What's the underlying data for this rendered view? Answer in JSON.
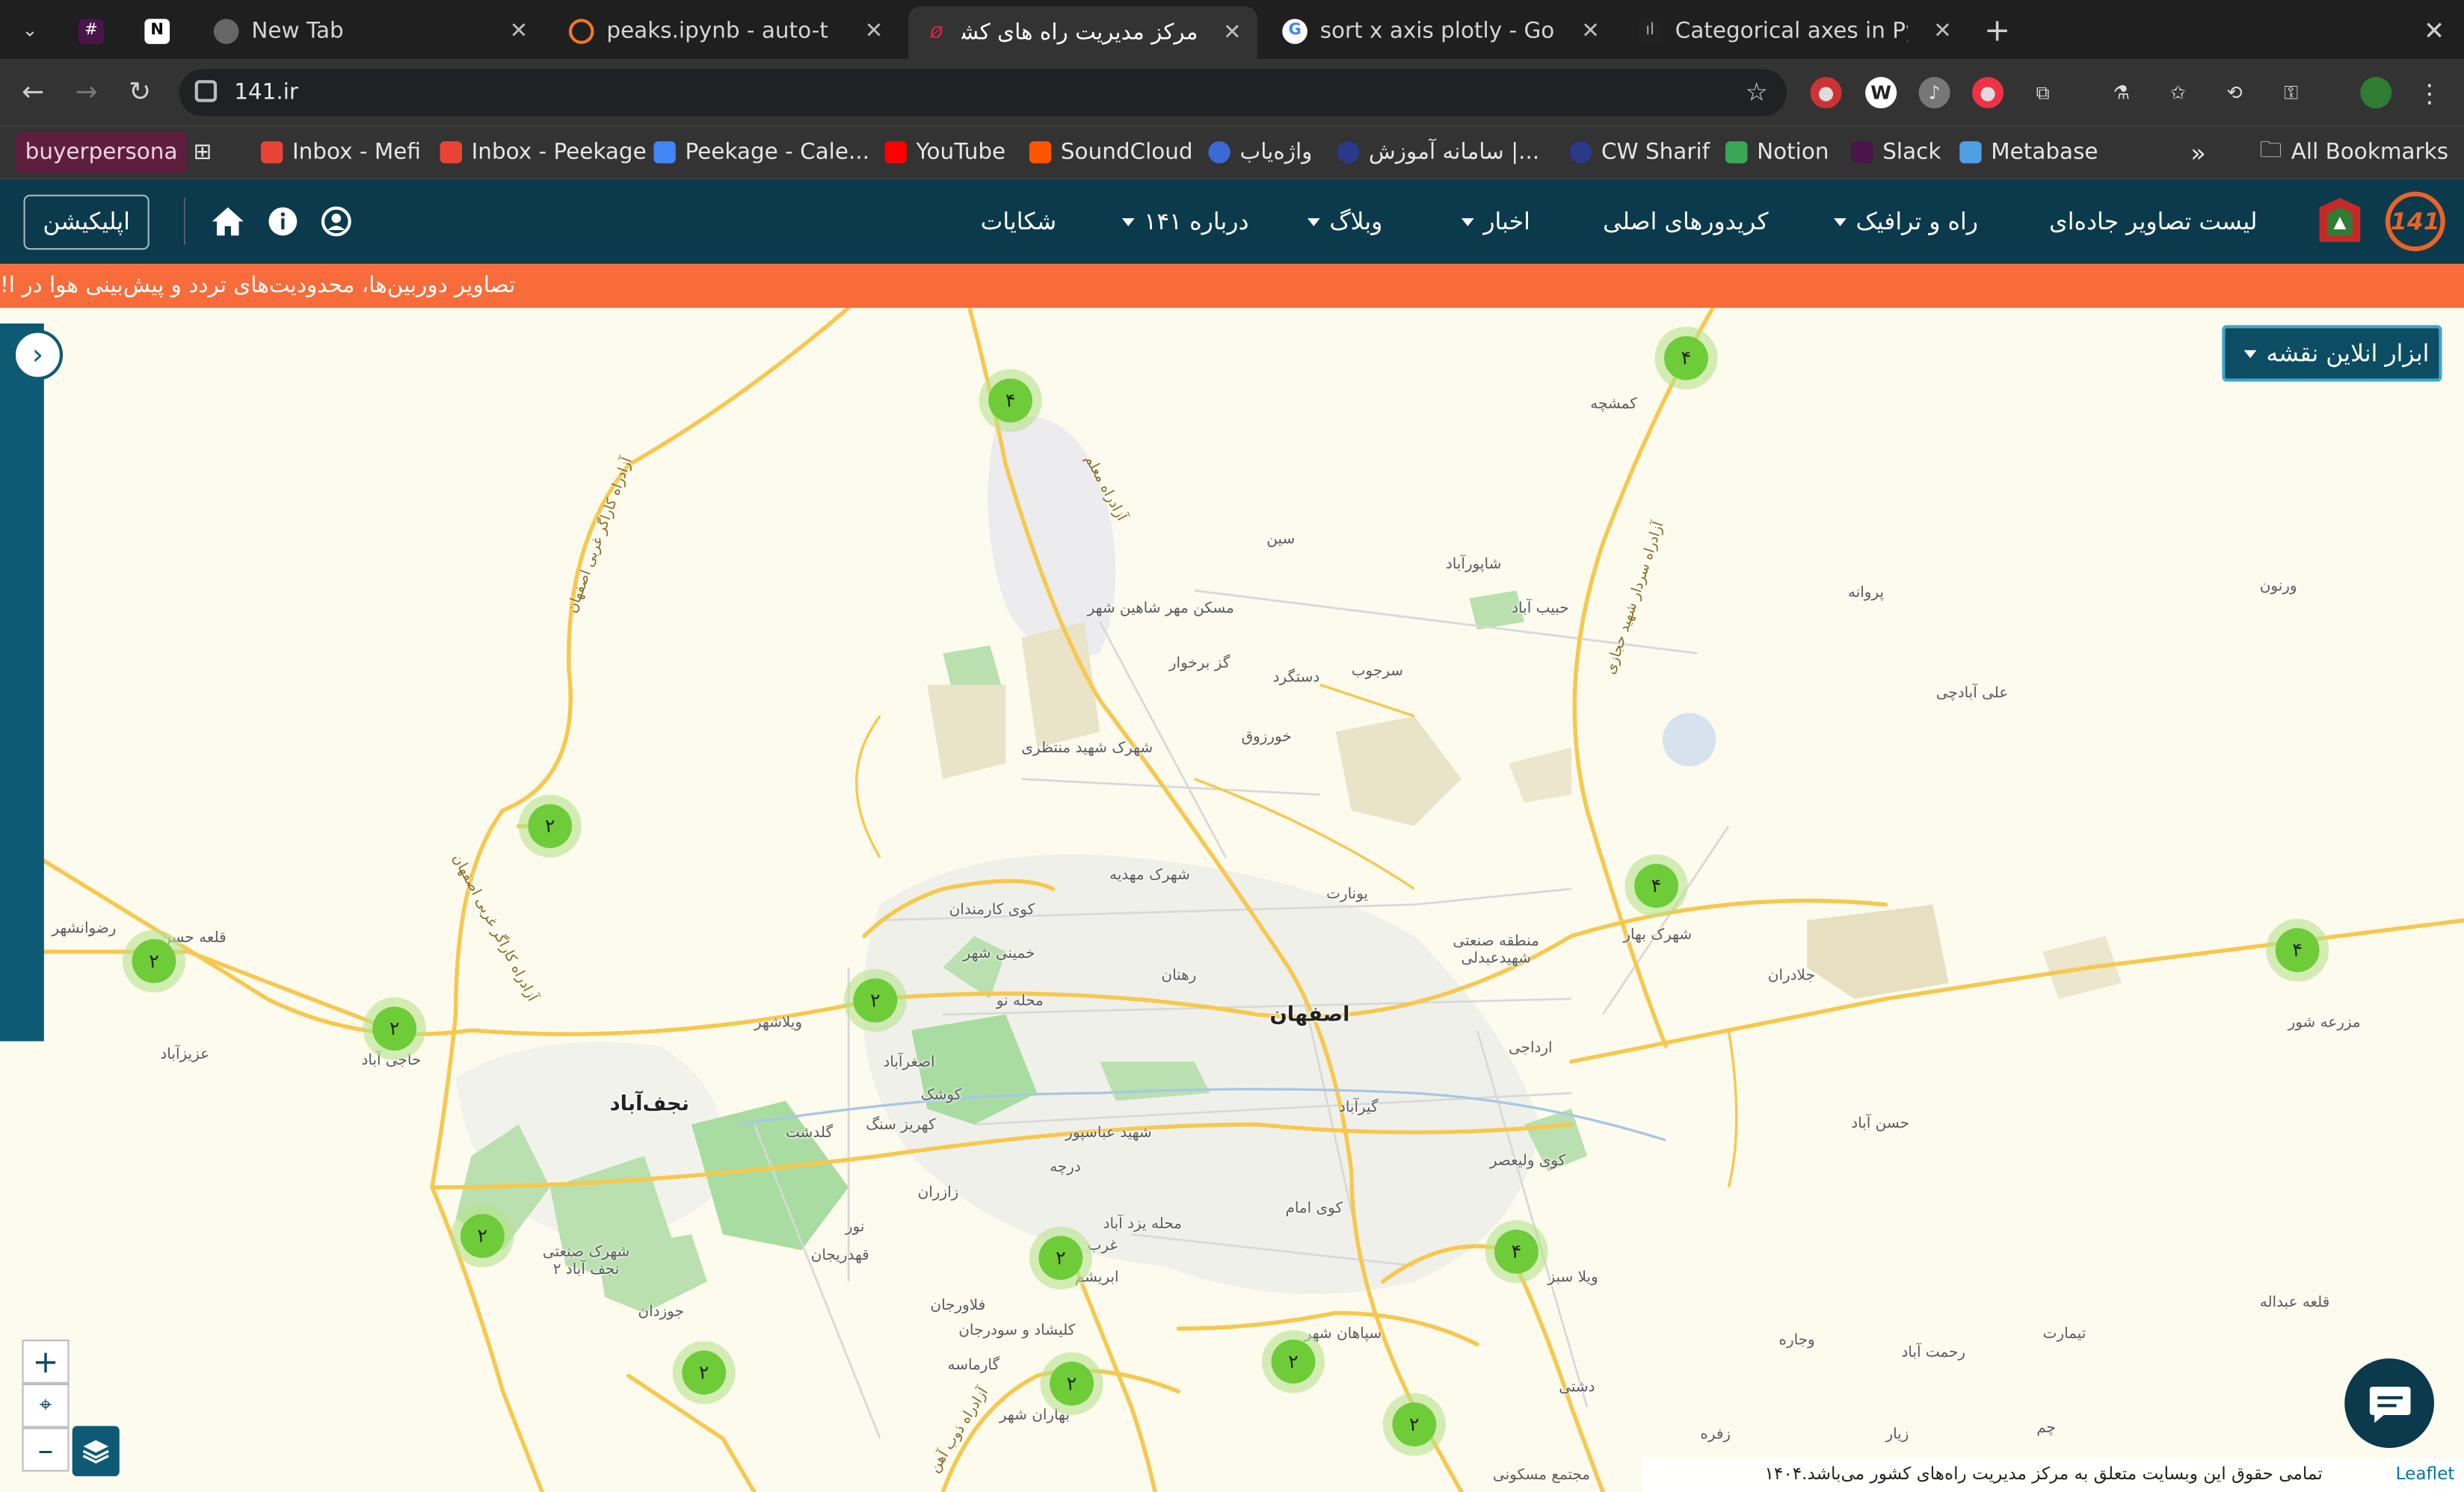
{
  "browser": {
    "tabs": [
      {
        "title": "",
        "icon": "slack-icon"
      },
      {
        "title": "",
        "icon": "notion-icon"
      },
      {
        "title": "New Tab",
        "icon": "chrome-icon"
      },
      {
        "title": "peaks.ipynb - auto-t",
        "icon": "jupyter-icon"
      },
      {
        "title": "مرکز مدیریت راه های کشور",
        "icon": "141-icon"
      },
      {
        "title": "sort x axis plotly - Google",
        "icon": "google-icon"
      },
      {
        "title": "Categorical axes in Pytho",
        "icon": "plotly-icon"
      }
    ],
    "url": "141.ir",
    "bookmarks": [
      "buyerpersona",
      "Inbox - Mefi",
      "Inbox - Peekage",
      "Peekage - Cale...",
      "YouTube",
      "SoundCloud",
      "واژه‌یاب",
      "سامانه آموزش |...",
      "CW Sharif",
      "Notion",
      "Slack",
      "Metabase"
    ],
    "all_bookmarks": "All Bookmarks",
    "more": "»"
  },
  "header": {
    "menu": [
      {
        "label": "لیست تصاویر جاده‌ای",
        "dropdown": false
      },
      {
        "label": "راه و ترافیک",
        "dropdown": true
      },
      {
        "label": "کریدورهای اصلی",
        "dropdown": false
      },
      {
        "label": "اخبار",
        "dropdown": true
      },
      {
        "label": "وبلاگ",
        "dropdown": true
      },
      {
        "label": "درباره ۱۴۱",
        "dropdown": true
      },
      {
        "label": "شکایات",
        "dropdown": false
      }
    ],
    "app_button": "اپلیکیشن"
  },
  "banner": "تصاویر دوربین‌ها، محدودیت‌های تردد و پیش‌بینی هوا در ا!",
  "map": {
    "tools_button": "ابزار انلاین نقشه",
    "city": "اصفهان",
    "places": [
      "نجف‌آباد",
      "کمشچه",
      "شاپورآباد",
      "سین",
      "حبیب آباد",
      "سرجوب",
      "دستگرد",
      "گز برخوار",
      "مسکن مهر شاهین شهر",
      "خورزوق",
      "شهرک شهید منتظری",
      "شهرک مهدیه",
      "کوی کارمندان",
      "خمینی شهر",
      "محله نو",
      "رهنان",
      "یونارت",
      "منطقه صنعتی شهیدعبدلی",
      "شهرک بهار",
      "جلادران",
      "پروانه",
      "ورنون",
      "علی آبادچی",
      "مزرعه شور",
      "حسن آباد",
      "ارداجی",
      "گیرآباد",
      "کوی ولیعصر",
      "کوی امام",
      "شهید عباسپور",
      "درچه",
      "کوشک",
      "کهریز سنگ",
      "اصغرآباد",
      "ویلاشهر",
      "گلدشت",
      "زازران",
      "محله یزد آباد",
      "ابریشم",
      "غرب",
      "نور",
      "قهدریجان",
      "فلاورجان",
      "جوزدان",
      "کلیشاد و سودرجان",
      "گارماسه",
      "بهاران شهر",
      "سپاهان شهر",
      "دشتی",
      "زفره",
      "زیار",
      "وجاره",
      "رحمت آباد",
      "تیمارت",
      "قلعه عبداله",
      "ویلا سبز",
      "مجتمع مسکونی",
      "حاجی آباد",
      "عزیزآباد",
      "قلعه حسن",
      "رضوانشهر",
      "شهرک صنعتی نجف آباد ۲",
      "چم"
    ],
    "roads": [
      "آزادراه کاراگر غربی اصفهان",
      "آزادراه معلم",
      "آزادراه سردار شهید حجازی",
      "آزادراه ذوب آهن",
      "آزادراه کاراگر غربی اصفهان"
    ],
    "clusters": [
      "۴",
      "۴",
      "۲",
      "۲",
      "۲",
      "۲",
      "۴",
      "۴",
      "۲",
      "۲",
      "۴",
      "۲",
      "۲",
      "۲",
      "۲"
    ],
    "zoom_in": "+",
    "zoom_out": "–",
    "footer_copy": "تمامی حقوق این وبسایت متعلق به مرکز مدیریت راه‌های کشور می‌باشد.۱۴۰۴",
    "leaflet": "Leaflet"
  },
  "colors": {
    "header_bg": "#0b3a4c",
    "banner_bg": "#f76c3a",
    "cluster_inner": "#6ecc39",
    "cluster_outer": "#b5e28c",
    "road": "#f9c74f",
    "park": "#a9dca0"
  }
}
